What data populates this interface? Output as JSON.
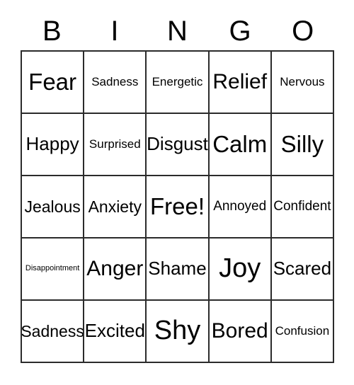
{
  "card": {
    "title": "BINGO",
    "header_letters": [
      "B",
      "I",
      "N",
      "G",
      "O"
    ],
    "grid": {
      "rows": 5,
      "columns": 5,
      "border_color": "#2b2b2b",
      "background_color": "#ffffff",
      "text_color": "#000000"
    },
    "cells": [
      [
        {
          "label": "Fear",
          "size": "xl"
        },
        {
          "label": "Sadness",
          "size": "xs"
        },
        {
          "label": "Energetic",
          "size": "xs"
        },
        {
          "label": "Relief",
          "size": "l"
        },
        {
          "label": "Nervous",
          "size": "xs"
        }
      ],
      [
        {
          "label": "Happy",
          "size": "ml"
        },
        {
          "label": "Surprised",
          "size": "xs"
        },
        {
          "label": "Disgust",
          "size": "ml"
        },
        {
          "label": "Calm",
          "size": "xl"
        },
        {
          "label": "Silly",
          "size": "xl"
        }
      ],
      [
        {
          "label": "Jealous",
          "size": "m"
        },
        {
          "label": "Anxiety",
          "size": "m"
        },
        {
          "label": "Free!",
          "size": "xl"
        },
        {
          "label": "Annoyed",
          "size": "s"
        },
        {
          "label": "Confident",
          "size": "s"
        }
      ],
      [
        {
          "label": "Disappointment",
          "size": "xxs"
        },
        {
          "label": "Anger",
          "size": "l"
        },
        {
          "label": "Shame",
          "size": "ml"
        },
        {
          "label": "Joy",
          "size": "xxl"
        },
        {
          "label": "Scared",
          "size": "ml"
        }
      ],
      [
        {
          "label": "Sadness",
          "size": "m"
        },
        {
          "label": "Excited",
          "size": "ml"
        },
        {
          "label": "Shy",
          "size": "xxl"
        },
        {
          "label": "Bored",
          "size": "l"
        },
        {
          "label": "Confusion",
          "size": "xs"
        }
      ]
    ]
  }
}
